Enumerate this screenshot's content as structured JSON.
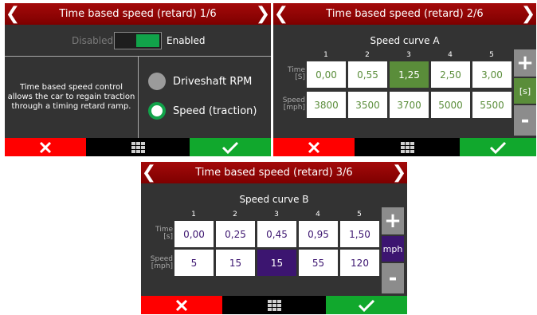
{
  "colors": {
    "title_bar": "#8b0000",
    "cancel": "#ff0000",
    "ok": "#11a82d",
    "curve_a_accent": "#5a8d3a",
    "curve_b_accent": "#3c1570"
  },
  "icons": {
    "prev": "chevron-left-icon",
    "next": "chevron-right-icon",
    "cancel": "x-icon",
    "menu": "grid-icon",
    "ok": "check-icon"
  },
  "screen1": {
    "title": "Time based speed (retard) 1/6",
    "toggle": {
      "off_label": "Disabled",
      "on_label": "Enabled",
      "state": "Enabled"
    },
    "description": "Time based speed control allows the car to regain traction through a timing retard ramp.",
    "options": [
      {
        "label": "Driveshaft RPM",
        "selected": false
      },
      {
        "label": "Speed (traction)",
        "selected": true
      }
    ]
  },
  "screen2": {
    "title": "Time based speed (retard) 2/6",
    "curve_title": "Speed curve A",
    "columns": [
      "1",
      "2",
      "3",
      "4",
      "5"
    ],
    "time_label": "Time",
    "time_unit": "[S]",
    "speed_label": "Speed",
    "speed_unit": "[mph]",
    "time_values": [
      "0,00",
      "0,55",
      "1,25",
      "2,50",
      "3,00"
    ],
    "speed_values": [
      "3800",
      "3500",
      "3700",
      "5000",
      "5500"
    ],
    "selected_cell": "time-3",
    "plus": "+",
    "unit_button": "[s]",
    "minus": "-"
  },
  "screen3": {
    "title": "Time based speed (retard) 3/6",
    "curve_title": "Speed curve B",
    "columns": [
      "1",
      "2",
      "3",
      "4",
      "5"
    ],
    "time_label": "Time",
    "time_unit": "[s]",
    "speed_label": "Speed",
    "speed_unit": "[mph]",
    "time_values": [
      "0,00",
      "0,25",
      "0,45",
      "0,95",
      "1,50"
    ],
    "speed_values": [
      "5",
      "15",
      "15",
      "55",
      "120"
    ],
    "selected_cell": "speed-3",
    "plus": "+",
    "unit_button": "mph",
    "minus": "-"
  }
}
